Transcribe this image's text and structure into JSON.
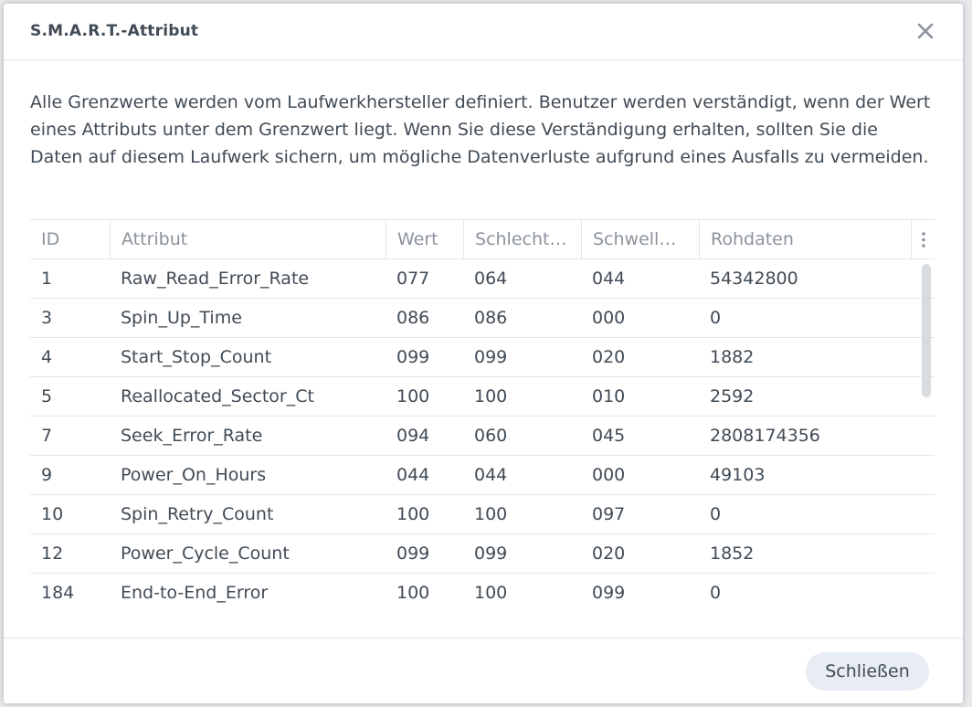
{
  "dialog": {
    "title": "S.M.A.R.T.-Attribut",
    "description": "Alle Grenzwerte werden vom Laufwerkhersteller definiert. Benutzer werden verständigt, wenn der Wert eines Attributs unter dem Grenzwert liegt. Wenn Sie diese Verständigung erhalten, sollten Sie die Daten auf diesem Laufwerk sichern, um mögliche Datenverluste aufgrund eines Ausfalls zu vermeiden.",
    "close_button_label": "Schließen"
  },
  "table": {
    "headers": {
      "id": "ID",
      "attribute": "Attribut",
      "value": "Wert",
      "worst": "Schlecht…",
      "threshold": "Schwell…",
      "raw": "Rohdaten"
    },
    "rows": [
      {
        "id": "1",
        "attribute": "Raw_Read_Error_Rate",
        "value": "077",
        "worst": "064",
        "threshold": "044",
        "raw": "54342800"
      },
      {
        "id": "3",
        "attribute": "Spin_Up_Time",
        "value": "086",
        "worst": "086",
        "threshold": "000",
        "raw": "0"
      },
      {
        "id": "4",
        "attribute": "Start_Stop_Count",
        "value": "099",
        "worst": "099",
        "threshold": "020",
        "raw": "1882"
      },
      {
        "id": "5",
        "attribute": "Reallocated_Sector_Ct",
        "value": "100",
        "worst": "100",
        "threshold": "010",
        "raw": "2592"
      },
      {
        "id": "7",
        "attribute": "Seek_Error_Rate",
        "value": "094",
        "worst": "060",
        "threshold": "045",
        "raw": "2808174356"
      },
      {
        "id": "9",
        "attribute": "Power_On_Hours",
        "value": "044",
        "worst": "044",
        "threshold": "000",
        "raw": "49103"
      },
      {
        "id": "10",
        "attribute": "Spin_Retry_Count",
        "value": "100",
        "worst": "100",
        "threshold": "097",
        "raw": "0"
      },
      {
        "id": "12",
        "attribute": "Power_Cycle_Count",
        "value": "099",
        "worst": "099",
        "threshold": "020",
        "raw": "1852"
      },
      {
        "id": "184",
        "attribute": "End-to-End_Error",
        "value": "100",
        "worst": "100",
        "threshold": "099",
        "raw": "0"
      }
    ]
  }
}
